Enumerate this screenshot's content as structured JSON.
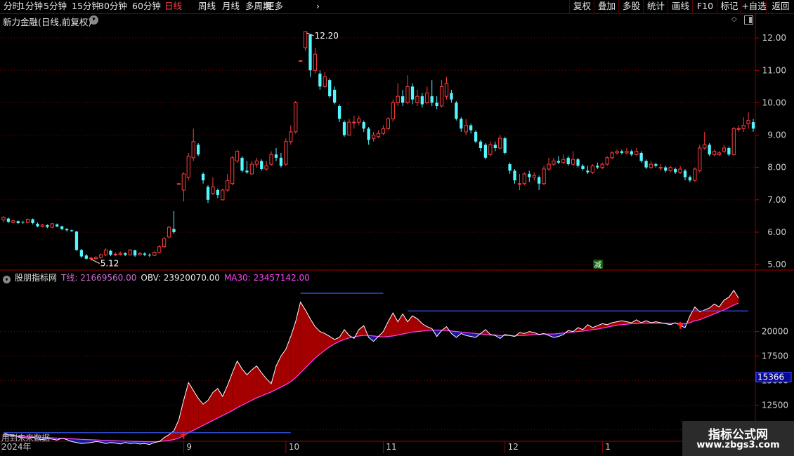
{
  "toolbar": {
    "periods": [
      "分时",
      "1分钟",
      "5分钟",
      "15分钟",
      "30分钟",
      "60分钟",
      "日线",
      "周线",
      "月线",
      "多周期",
      "更多"
    ],
    "active_period": "日线",
    "right_buttons": [
      "复权",
      "叠加",
      "多股",
      "统计",
      "画线",
      "F10",
      "标记",
      "+自选",
      "返回"
    ]
  },
  "stock": {
    "title": "新力金融(日线,前复权)",
    "high_label": "12.20",
    "low_label": "5.12",
    "reduce_badge": "减",
    "price_ticks": [
      "12.00",
      "11.00",
      "10.00",
      "9.00",
      "8.00",
      "7.00",
      "6.00",
      "5.00"
    ]
  },
  "indicator": {
    "source": "股朋指标网",
    "t_label": "T线: 21669560.00",
    "obv_label": "OBV: 23920070.00",
    "ma_label": "MA30: 23457142.00",
    "value_ticks": [
      "20000",
      "17500",
      "15000",
      "12500",
      "10000"
    ],
    "current_value": "15366",
    "footer_text": "用到未来数据"
  },
  "date_axis": [
    "2024年",
    "9",
    "10",
    "11",
    "12",
    "1",
    "2"
  ],
  "watermark": {
    "line1": "指标公式网",
    "line2": "www.zbgs3.com"
  },
  "colors": {
    "up": "#ff3d3d",
    "down": "#54f7ff",
    "grid": "#8b0000",
    "obv": "#ffffff",
    "ma": "#ff40ff",
    "blue": "#3a5cff",
    "fill_red": "#a50000",
    "fill_blue": "#1a1aa0"
  },
  "chart_data": {
    "type": "candlestick",
    "ylim": [
      4.85,
      12.35
    ],
    "candles": [
      [
        6.38,
        6.46,
        6.3,
        6.5
      ],
      [
        6.42,
        6.32,
        6.28,
        6.45
      ],
      [
        6.3,
        6.35,
        6.27,
        6.38
      ],
      [
        6.34,
        6.28,
        6.25,
        6.36
      ],
      [
        6.32,
        6.3,
        6.26,
        6.34
      ],
      [
        6.3,
        6.4,
        6.28,
        6.42
      ],
      [
        6.4,
        6.28,
        6.24,
        6.42
      ],
      [
        6.26,
        6.18,
        6.15,
        6.3
      ],
      [
        6.18,
        6.22,
        6.15,
        6.26
      ],
      [
        6.22,
        6.16,
        6.12,
        6.24
      ],
      [
        6.15,
        6.26,
        6.12,
        6.28
      ],
      [
        6.24,
        6.18,
        6.15,
        6.27
      ],
      [
        6.18,
        6.1,
        6.06,
        6.2
      ],
      [
        6.1,
        6.06,
        6.02,
        6.12
      ],
      [
        6.06,
        6.04,
        6.0,
        6.08
      ],
      [
        6.02,
        5.45,
        5.42,
        6.04
      ],
      [
        5.45,
        5.25,
        5.2,
        5.48
      ],
      [
        5.28,
        5.18,
        5.15,
        5.32
      ],
      [
        5.2,
        5.2,
        5.12,
        5.24
      ],
      [
        5.18,
        5.22,
        5.14,
        5.26
      ],
      [
        5.22,
        5.3,
        5.18,
        5.34
      ],
      [
        5.3,
        5.45,
        5.26,
        5.5
      ],
      [
        5.42,
        5.3,
        5.26,
        5.46
      ],
      [
        5.3,
        5.32,
        5.26,
        5.38
      ],
      [
        5.32,
        5.35,
        5.28,
        5.4
      ],
      [
        5.35,
        5.3,
        5.26,
        5.38
      ],
      [
        5.3,
        5.45,
        5.28,
        5.48
      ],
      [
        5.44,
        5.28,
        5.24,
        5.46
      ],
      [
        5.3,
        5.34,
        5.28,
        5.38
      ],
      [
        5.34,
        5.3,
        5.26,
        5.38
      ],
      [
        5.3,
        5.28,
        5.24,
        5.34
      ],
      [
        5.28,
        5.38,
        5.26,
        5.42
      ],
      [
        5.38,
        5.55,
        5.35,
        5.6
      ],
      [
        5.55,
        5.8,
        5.5,
        5.85
      ],
      [
        5.85,
        6.15,
        5.8,
        6.2
      ],
      [
        6.1,
        6.0,
        5.95,
        6.65
      ],
      [
        7.5,
        7.5,
        7.5,
        7.5
      ],
      [
        7.3,
        7.8,
        6.95,
        7.85
      ],
      [
        7.7,
        8.35,
        7.6,
        8.45
      ],
      [
        8.3,
        8.8,
        8.2,
        9.2
      ],
      [
        8.7,
        8.4,
        8.35,
        8.75
      ],
      [
        7.8,
        7.6,
        7.5,
        7.85
      ],
      [
        7.4,
        7.0,
        6.9,
        7.45
      ],
      [
        7.2,
        7.4,
        7.15,
        7.7
      ],
      [
        7.3,
        7.15,
        7.05,
        7.35
      ],
      [
        7.0,
        7.3,
        6.98,
        7.35
      ],
      [
        7.3,
        7.6,
        7.25,
        7.8
      ],
      [
        7.5,
        8.3,
        7.45,
        8.35
      ],
      [
        8.2,
        8.5,
        8.15,
        8.55
      ],
      [
        8.3,
        7.9,
        7.85,
        8.35
      ],
      [
        7.9,
        7.85,
        7.8,
        8.2
      ],
      [
        7.8,
        8.1,
        7.78,
        8.2
      ],
      [
        8.1,
        8.2,
        8.0,
        8.3
      ],
      [
        8.2,
        7.95,
        7.9,
        8.25
      ],
      [
        7.95,
        8.05,
        7.9,
        8.2
      ],
      [
        8.1,
        8.4,
        8.05,
        8.5
      ],
      [
        8.4,
        8.3,
        8.2,
        8.6
      ],
      [
        8.3,
        8.05,
        8.0,
        8.45
      ],
      [
        8.1,
        8.8,
        8.05,
        8.9
      ],
      [
        8.8,
        9.1,
        8.7,
        9.3
      ],
      [
        9.1,
        10.0,
        9.05,
        10.05
      ],
      [
        11.3,
        11.3,
        11.3,
        11.3
      ],
      [
        11.7,
        12.2,
        11.6,
        12.2
      ],
      [
        12.1,
        11.0,
        10.8,
        12.1
      ],
      [
        11.0,
        11.5,
        10.9,
        11.7
      ],
      [
        10.9,
        10.5,
        10.4,
        11.0
      ],
      [
        10.5,
        10.8,
        10.45,
        10.95
      ],
      [
        10.7,
        10.2,
        10.15,
        10.75
      ],
      [
        10.4,
        10.0,
        9.95,
        10.5
      ],
      [
        9.9,
        9.5,
        9.4,
        9.95
      ],
      [
        9.4,
        9.0,
        8.95,
        9.45
      ],
      [
        9.0,
        9.4,
        8.98,
        9.5
      ],
      [
        9.4,
        9.4,
        9.2,
        9.6
      ],
      [
        9.4,
        9.5,
        9.3,
        9.6
      ],
      [
        9.4,
        9.2,
        9.1,
        9.45
      ],
      [
        9.2,
        8.85,
        8.7,
        9.25
      ],
      [
        8.9,
        9.0,
        8.8,
        9.1
      ],
      [
        8.95,
        9.05,
        8.9,
        9.15
      ],
      [
        9.05,
        9.2,
        9.0,
        9.3
      ],
      [
        9.2,
        9.5,
        9.15,
        9.55
      ],
      [
        9.5,
        10.0,
        9.4,
        10.1
      ],
      [
        10.0,
        10.2,
        9.9,
        10.6
      ],
      [
        10.2,
        10.0,
        9.9,
        10.4
      ],
      [
        10.0,
        10.5,
        9.95,
        10.85
      ],
      [
        10.5,
        10.1,
        9.95,
        10.6
      ],
      [
        10.0,
        10.2,
        9.9,
        10.4
      ],
      [
        10.2,
        9.95,
        9.85,
        10.3
      ],
      [
        10.0,
        10.3,
        9.95,
        10.5
      ],
      [
        10.2,
        10.0,
        9.9,
        10.7
      ],
      [
        10.0,
        9.9,
        9.8,
        10.2
      ],
      [
        9.9,
        10.5,
        9.85,
        10.7
      ],
      [
        10.2,
        10.6,
        10.1,
        10.8
      ],
      [
        10.3,
        10.1,
        10.0,
        10.4
      ],
      [
        10.0,
        9.5,
        9.45,
        10.05
      ],
      [
        9.5,
        9.2,
        9.1,
        9.55
      ],
      [
        9.1,
        9.3,
        9.0,
        9.5
      ],
      [
        9.3,
        9.15,
        9.05,
        9.35
      ],
      [
        9.1,
        8.8,
        8.75,
        9.15
      ],
      [
        8.8,
        8.6,
        8.5,
        8.85
      ],
      [
        8.7,
        8.3,
        8.25,
        8.75
      ],
      [
        8.4,
        8.7,
        8.35,
        8.8
      ],
      [
        8.7,
        8.6,
        8.5,
        8.8
      ],
      [
        8.6,
        8.9,
        8.55,
        9.0
      ],
      [
        8.9,
        8.45,
        8.4,
        8.95
      ],
      [
        8.1,
        7.9,
        7.8,
        8.15
      ],
      [
        7.9,
        7.6,
        7.5,
        7.95
      ],
      [
        7.5,
        7.5,
        7.3,
        7.8
      ],
      [
        7.5,
        7.8,
        7.45,
        7.85
      ],
      [
        7.8,
        7.7,
        7.55,
        7.9
      ],
      [
        7.7,
        7.75,
        7.6,
        7.85
      ],
      [
        7.7,
        7.5,
        7.3,
        7.75
      ],
      [
        7.5,
        7.95,
        7.45,
        8.05
      ],
      [
        7.95,
        8.1,
        7.9,
        8.3
      ],
      [
        8.1,
        8.2,
        8.05,
        8.3
      ],
      [
        8.2,
        8.15,
        8.1,
        8.35
      ],
      [
        8.15,
        8.25,
        8.1,
        8.4
      ],
      [
        8.3,
        8.1,
        8.05,
        8.35
      ],
      [
        8.1,
        8.25,
        8.05,
        8.5
      ],
      [
        8.25,
        8.05,
        8.0,
        8.3
      ],
      [
        8.05,
        7.95,
        7.9,
        8.1
      ],
      [
        7.9,
        7.85,
        7.8,
        8.05
      ],
      [
        7.85,
        8.05,
        7.8,
        8.1
      ],
      [
        8.05,
        8.0,
        7.95,
        8.15
      ],
      [
        8.0,
        8.1,
        7.95,
        8.15
      ],
      [
        8.1,
        8.3,
        8.05,
        8.35
      ],
      [
        8.3,
        8.45,
        8.25,
        8.5
      ],
      [
        8.45,
        8.5,
        8.4,
        8.55
      ],
      [
        8.5,
        8.45,
        8.4,
        8.55
      ],
      [
        8.45,
        8.5,
        8.4,
        8.6
      ],
      [
        8.5,
        8.4,
        8.35,
        8.55
      ],
      [
        8.4,
        8.5,
        8.35,
        8.6
      ],
      [
        8.45,
        8.2,
        8.15,
        8.5
      ],
      [
        8.2,
        8.0,
        7.95,
        8.25
      ],
      [
        8.0,
        8.1,
        7.95,
        8.2
      ],
      [
        8.1,
        8.05,
        8.0,
        8.15
      ],
      [
        8.0,
        8.0,
        7.9,
        8.1
      ],
      [
        8.0,
        7.9,
        7.85,
        8.05
      ],
      [
        7.9,
        8.0,
        7.85,
        8.05
      ],
      [
        7.95,
        7.85,
        7.8,
        8.0
      ],
      [
        7.85,
        7.95,
        7.8,
        8.05
      ],
      [
        7.9,
        7.7,
        7.6,
        7.95
      ],
      [
        7.7,
        7.6,
        7.55,
        7.75
      ],
      [
        7.6,
        7.95,
        7.55,
        8.0
      ],
      [
        7.9,
        8.6,
        7.85,
        8.7
      ],
      [
        8.6,
        8.7,
        8.55,
        9.1
      ],
      [
        8.7,
        8.4,
        8.35,
        8.75
      ],
      [
        8.4,
        8.5,
        8.35,
        8.55
      ],
      [
        8.4,
        8.45,
        8.35,
        8.5
      ],
      [
        8.5,
        8.6,
        8.45,
        8.7
      ],
      [
        8.6,
        8.4,
        8.35,
        8.65
      ],
      [
        8.4,
        9.2,
        8.35,
        9.25
      ],
      [
        9.2,
        9.2,
        9.1,
        9.3
      ],
      [
        9.2,
        9.3,
        9.1,
        9.55
      ],
      [
        9.35,
        9.45,
        9.2,
        9.7
      ],
      [
        9.4,
        9.2,
        9.1,
        9.5
      ]
    ],
    "indicator_ylim": [
      8900,
      24900
    ],
    "obv": [
      9700,
      9500,
      9450,
      9300,
      9200,
      9150,
      9250,
      9050,
      9000,
      9100,
      9050,
      8950,
      9150,
      9000,
      8800,
      8700,
      8600,
      8650,
      8700,
      8800,
      8750,
      8600,
      8700,
      8650,
      8550,
      8700,
      8600,
      8650,
      8550,
      8600,
      8500,
      8700,
      8800,
      9200,
      9500,
      9900,
      11000,
      13000,
      14800,
      14000,
      13200,
      12600,
      13000,
      13800,
      14200,
      13400,
      14500,
      15800,
      17000,
      16200,
      15600,
      16100,
      16500,
      15800,
      15200,
      14700,
      16500,
      17500,
      18200,
      19500,
      21000,
      23000,
      22200,
      21300,
      20500,
      20000,
      19800,
      19500,
      19200,
      19400,
      20200,
      19600,
      19300,
      20200,
      20600,
      19400,
      19000,
      19500,
      20000,
      21000,
      21900,
      21000,
      21800,
      21000,
      21600,
      21300,
      20800,
      20500,
      20300,
      19500,
      20100,
      20500,
      19800,
      19400,
      19800,
      19600,
      19500,
      19400,
      19800,
      20200,
      19700,
      19600,
      19300,
      19700,
      19600,
      19500,
      19900,
      19800,
      20000,
      19900,
      19700,
      19800,
      19600,
      19400,
      19500,
      19700,
      20100,
      20000,
      20400,
      20200,
      20700,
      20400,
      20600,
      20800,
      20700,
      20900,
      21000,
      21100,
      21000,
      20900,
      21200,
      20900,
      21100,
      20900,
      21000,
      20900,
      20800,
      20700,
      20900,
      20600,
      20400,
      21600,
      22500,
      22000,
      22200,
      22400,
      22800,
      22500,
      23200,
      23500,
      24200,
      23400
    ],
    "ma30": [
      9400,
      9400,
      9380,
      9350,
      9330,
      9300,
      9280,
      9250,
      9220,
      9200,
      9180,
      9150,
      9130,
      9100,
      9080,
      9050,
      9020,
      9000,
      8980,
      8960,
      8940,
      8920,
      8900,
      8880,
      8860,
      8850,
      8830,
      8820,
      8800,
      8790,
      8780,
      8780,
      8800,
      8850,
      8920,
      9000,
      9150,
      9400,
      9700,
      9950,
      10200,
      10450,
      10700,
      10950,
      11200,
      11450,
      11700,
      11950,
      12250,
      12500,
      12750,
      13000,
      13250,
      13450,
      13650,
      13850,
      14100,
      14350,
      14600,
      14900,
      15300,
      15800,
      16300,
      16800,
      17300,
      17700,
      18100,
      18450,
      18750,
      19000,
      19200,
      19350,
      19450,
      19550,
      19600,
      19600,
      19550,
      19500,
      19450,
      19500,
      19550,
      19650,
      19750,
      19850,
      19950,
      20000,
      20050,
      20100,
      20150,
      20150,
      20150,
      20100,
      20050,
      20000,
      19950,
      19900,
      19850,
      19800,
      19750,
      19700,
      19650,
      19650,
      19600,
      19600,
      19600,
      19550,
      19600,
      19600,
      19650,
      19700,
      19700,
      19750,
      19750,
      19750,
      19800,
      19850,
      19900,
      19950,
      20000,
      20050,
      20100,
      20200,
      20250,
      20350,
      20450,
      20550,
      20650,
      20700,
      20750,
      20800,
      20800,
      20850,
      20850,
      20850,
      20850,
      20850,
      20850,
      20850,
      20850,
      20850,
      20800,
      20900,
      21100,
      21200,
      21400,
      21600,
      21800,
      22000,
      22200,
      22450,
      22700,
      22900
    ],
    "h_lines": [
      {
        "value": 9700,
        "from": 0,
        "to": 59
      },
      {
        "value": 23900,
        "from": 61,
        "to": 78
      },
      {
        "value": 22100,
        "from": 83,
        "to": 153
      }
    ],
    "high_index": 62,
    "low_index": 18
  }
}
